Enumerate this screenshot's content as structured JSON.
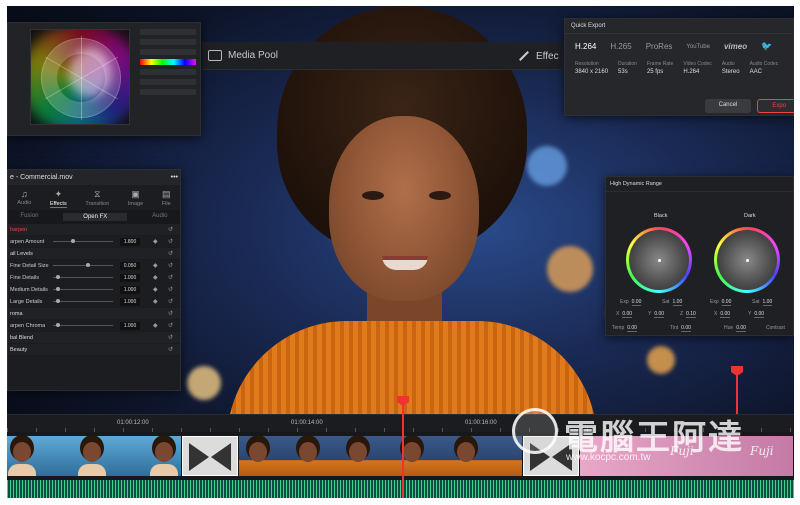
{
  "toolbar": {
    "media_pool_label": "Media Pool",
    "effects_label": "Effec"
  },
  "quick_export": {
    "title": "Quick Export",
    "tabs": [
      "H.264",
      "H.265",
      "ProRes",
      "YouTube",
      "vimeo"
    ],
    "meta": [
      {
        "label": "Resolution",
        "value": "3840 x 2160"
      },
      {
        "label": "Duration",
        "value": "53s"
      },
      {
        "label": "Frame Rate",
        "value": "25 fps"
      },
      {
        "label": "Video Codec",
        "value": "H.264"
      },
      {
        "label": "Audio",
        "value": "Stereo"
      },
      {
        "label": "Audio Codec",
        "value": "AAC"
      }
    ],
    "cancel_label": "Cancel",
    "export_label": "Expo"
  },
  "effects_panel": {
    "title": "e - Commercial.mov",
    "tabs": [
      "Audio",
      "Effects",
      "Transition",
      "Image",
      "File"
    ],
    "subtabs": [
      "Fusion",
      "Open FX",
      "Audio"
    ],
    "rows": [
      {
        "label": "harpen",
        "type": "section-red"
      },
      {
        "label": "arpen Amount",
        "value": "1.800",
        "knob": 0.3
      },
      {
        "label": "ail Levels",
        "type": "section"
      },
      {
        "label": "Fine Detail Size",
        "value": "0.050",
        "knob": 0.55
      },
      {
        "label": "Fine Details",
        "value": "1.000",
        "knob": 0.05
      },
      {
        "label": "Medium Details",
        "value": "1.000",
        "knob": 0.05
      },
      {
        "label": "Large Details",
        "value": "1.000",
        "knob": 0.05
      },
      {
        "label": "roma",
        "type": "section"
      },
      {
        "label": "arpen Chroma",
        "value": "1.000",
        "knob": 0.05
      },
      {
        "label": "bal Blend",
        "type": "section"
      },
      {
        "label": "Beauty",
        "type": "section"
      }
    ]
  },
  "hdr_panel": {
    "title": "High Dynamic Range",
    "left_wheel": "Black",
    "right_wheel": "Dark",
    "left_exp_label": "Exp",
    "left_exp": "0.00",
    "left_sat_label": "Sat",
    "left_sat": "1.00",
    "right_exp_label": "Exp",
    "right_exp": "0.00",
    "right_sat_label": "Sat",
    "right_sat": "1.00",
    "left_x_label": "X",
    "left_x": "0.00",
    "left_y_label": "Y",
    "left_y": "0.00",
    "left_z_label": "Z",
    "left_z": "0.10",
    "right_x_label": "X",
    "right_x": "0.00",
    "right_y_label": "Y",
    "right_y": "0.00",
    "temp_label": "Temp",
    "temp": "0.00",
    "tint_label": "Tint",
    "tint": "0.00",
    "hue_label": "Hue",
    "hue": "0.00",
    "contrast_label": "Contrast"
  },
  "timeline": {
    "timecodes": [
      "01:00:12:00",
      "01:00:14:00",
      "01:00:16:00"
    ],
    "clip_text": [
      "Fuji",
      "Fuji"
    ]
  },
  "watermark": {
    "text": "電腦王阿達",
    "url": "www.kocpc.com.tw"
  },
  "colors": {
    "accent": "#e33333",
    "sweater": "#e07a1d",
    "panel_bg": "#1e1f22",
    "audio_wave": "#3fd39a"
  }
}
